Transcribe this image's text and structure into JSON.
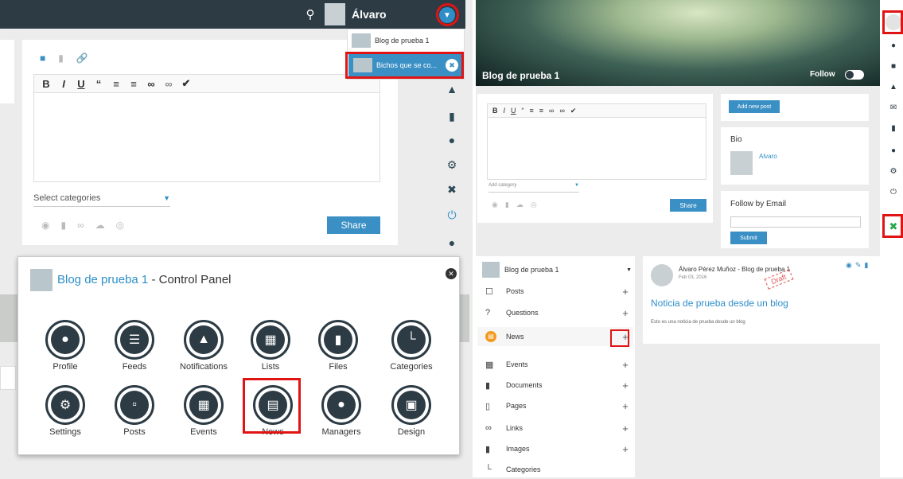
{
  "left": {
    "header": {
      "user_name": "Álvaro"
    },
    "dropdown": {
      "items": [
        {
          "label": "Blog de prueba 1"
        },
        {
          "label": "Bichos que se co..."
        }
      ]
    },
    "editor": {
      "select_placeholder": "Select categories",
      "share_label": "Share"
    }
  },
  "control_panel": {
    "blog_name": "Blog de prueba 1",
    "title_suffix": "Control Panel",
    "row1": [
      {
        "label": "Profile",
        "icon": "person-icon"
      },
      {
        "label": "Feeds",
        "icon": "feeds-icon"
      },
      {
        "label": "Notifications",
        "icon": "bell-icon"
      },
      {
        "label": "Lists",
        "icon": "lists-icon"
      },
      {
        "label": "Files",
        "icon": "files-icon"
      },
      {
        "label": "Categories",
        "icon": "categories-icon"
      }
    ],
    "row2": [
      {
        "label": "Settings",
        "icon": "gears-icon"
      },
      {
        "label": "Posts",
        "icon": "posts-icon"
      },
      {
        "label": "Events",
        "icon": "calendar-icon"
      },
      {
        "label": "News",
        "icon": "news-icon"
      },
      {
        "label": "Managers",
        "icon": "managers-icon"
      },
      {
        "label": "Design",
        "icon": "design-icon"
      }
    ]
  },
  "right": {
    "blog_title": "Blog de prueba 1",
    "follow_label": "Follow",
    "add_post_label": "Add new post",
    "bio": {
      "heading": "Bio",
      "author": "Alvaro"
    },
    "follow_email": {
      "heading": "Follow by Email",
      "submit": "Submit"
    },
    "editor": {
      "category_placeholder": "Add category",
      "share_label": "Share"
    },
    "menu": {
      "header": "Blog de prueba 1",
      "items": [
        {
          "label": "Posts",
          "add": "+"
        },
        {
          "label": "Questions",
          "add": "+"
        },
        {
          "label": "News",
          "add": "+"
        },
        {
          "label": "Events",
          "add": "+"
        },
        {
          "label": "Documents",
          "add": "+"
        },
        {
          "label": "Pages",
          "add": "+"
        },
        {
          "label": "Links",
          "add": "+"
        },
        {
          "label": "Images",
          "add": "+"
        },
        {
          "label": "Categories",
          "add": ""
        }
      ]
    },
    "post": {
      "author_line": "Álvaro Pérez Muñoz - Blog de prueba 1",
      "date": "Feb 03, 2016",
      "stamp": "Draft",
      "title": "Noticia de prueba desde un blog",
      "body": "Esto es una noticia de prueba desde un blog"
    }
  }
}
